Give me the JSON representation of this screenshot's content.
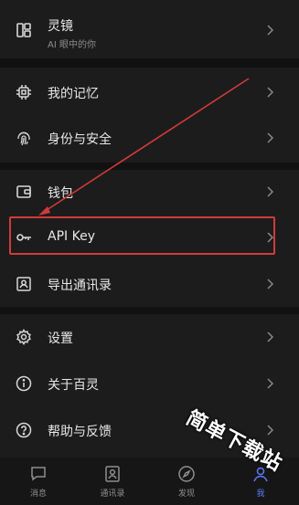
{
  "menu": {
    "lingjing": {
      "label": "灵镜",
      "sub": "AI 眼中的你",
      "icon": "layout-panel-icon"
    },
    "memory": {
      "label": "我的记忆",
      "icon": "chip-icon"
    },
    "identity": {
      "label": "身份与安全",
      "icon": "fingerprint-icon"
    },
    "wallet": {
      "label": "钱包",
      "icon": "wallet-icon"
    },
    "apikey": {
      "label": "API Key",
      "icon": "key-icon"
    },
    "export": {
      "label": "导出通讯录",
      "icon": "contact-card-icon"
    },
    "settings": {
      "label": "设置",
      "icon": "gear-icon"
    },
    "about": {
      "label": "关于百灵",
      "icon": "info-icon"
    },
    "help": {
      "label": "帮助与反馈",
      "icon": "question-icon"
    }
  },
  "tabs": [
    {
      "label": "消息",
      "icon": "message-icon"
    },
    {
      "label": "通讯录",
      "icon": "contacts-icon"
    },
    {
      "label": "发现",
      "icon": "compass-icon"
    },
    {
      "label": "我",
      "icon": "me-icon"
    }
  ],
  "overlay": {
    "watermark": "简单下载站",
    "highlight_color": "#d23a3a"
  }
}
